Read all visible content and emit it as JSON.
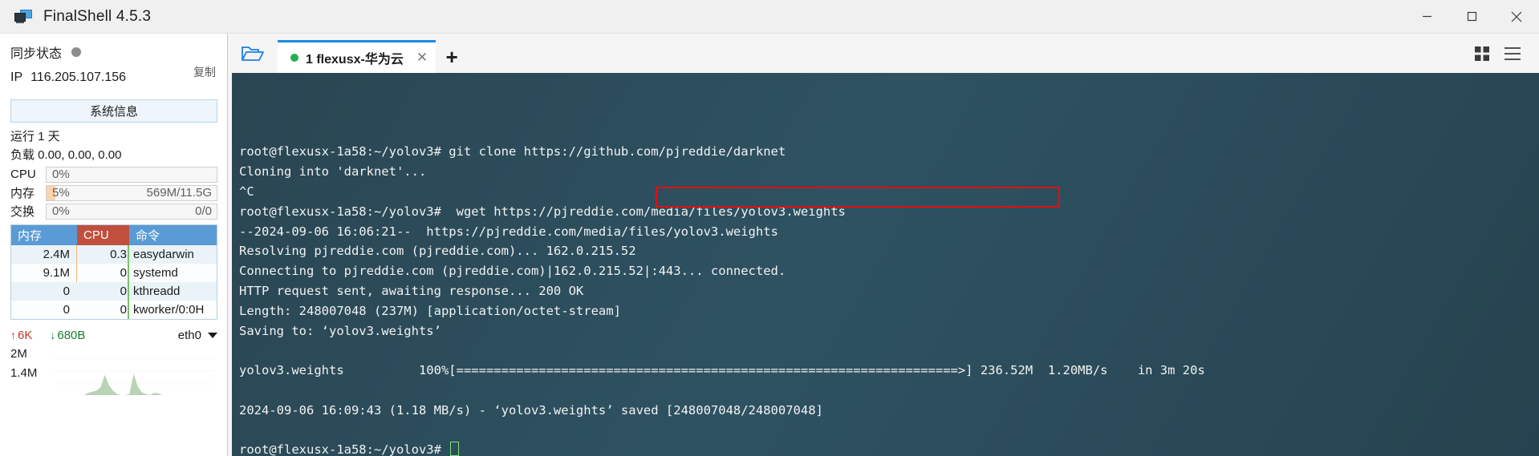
{
  "window": {
    "title": "FinalShell 4.5.3",
    "app_icon": "monitor-icon",
    "minimize": "–",
    "maximize": "□",
    "close": "✕"
  },
  "sidebar": {
    "sync_label": "同步状态",
    "sync_status_color": "#8d8d8d",
    "ip_key": "IP",
    "ip_value": "116.205.107.156",
    "copy_label": "复制",
    "sysinfo_button": "系统信息",
    "uptime": "运行 1 天",
    "load": "负载 0.00, 0.00, 0.00",
    "meters": [
      {
        "label": "CPU",
        "pct": "0%",
        "fill_pct": 0,
        "aux": ""
      },
      {
        "label": "内存",
        "pct": "5%",
        "fill_pct": 5,
        "aux": "569M/11.5G"
      },
      {
        "label": "交换",
        "pct": "0%",
        "fill_pct": 0,
        "aux": "0/0"
      }
    ],
    "proc_table": {
      "headers": {
        "mem": "内存",
        "cpu": "CPU",
        "cmd": "命令"
      },
      "header_colors": {
        "mem": "#5b9bd5",
        "cpu": "#c0503d",
        "cmd": "#5b9bd5"
      },
      "rows": [
        {
          "mem": "2.4M",
          "cpu": "0.3",
          "cmd": "easydarwin"
        },
        {
          "mem": "9.1M",
          "cpu": "0",
          "cmd": "systemd"
        },
        {
          "mem": "0",
          "cpu": "0",
          "cmd": "kthreadd"
        },
        {
          "mem": "0",
          "cpu": "0",
          "cmd": "kworker/0:0H"
        }
      ]
    },
    "net": {
      "up_arrow": "↑",
      "up_value": "6K",
      "down_arrow": "↓",
      "down_value": "680B",
      "interface": "eth0",
      "graph_top_label": "2M",
      "graph_mid_label": "1.4M"
    }
  },
  "tabbar": {
    "folder_icon": "open-folder-icon",
    "tabs": [
      {
        "label": "1 flexusx-华为云",
        "status_color": "#22b14c",
        "close": "✕",
        "active": true
      }
    ],
    "new_tab": "+",
    "right_icons": [
      "grid-view-icon",
      "menu-icon"
    ]
  },
  "terminal": {
    "highlight_color": "#e10f0f",
    "lines": [
      "root@flexusx-1a58:~/yolov3# git clone https://github.com/pjreddie/darknet",
      "Cloning into 'darknet'...",
      "^C",
      "root@flexusx-1a58:~/yolov3#  wget https://pjreddie.com/media/files/yolov3.weights",
      "--2024-09-06 16:06:21--  https://pjreddie.com/media/files/yolov3.weights",
      "Resolving pjreddie.com (pjreddie.com)... 162.0.215.52",
      "Connecting to pjreddie.com (pjreddie.com)|162.0.215.52|:443... connected.",
      "HTTP request sent, awaiting response... 200 OK",
      "Length: 248007048 (237M) [application/octet-stream]",
      "Saving to: ‘yolov3.weights’",
      "",
      "yolov3.weights          100%[===================================================================>] 236.52M  1.20MB/s    in 3m 20s",
      "",
      "2024-09-06 16:09:43 (1.18 MB/s) - ‘yolov3.weights’ saved [248007048/248007048]",
      ""
    ],
    "prompt": "root@flexusx-1a58:~/yolov3# ",
    "cursor": "block-cursor"
  },
  "chart_data": {
    "type": "area",
    "title": "",
    "xlabel": "",
    "ylabel": "",
    "categories": [],
    "values": [
      0,
      0,
      0,
      0,
      0,
      0,
      0,
      0,
      0.1,
      0.15,
      0.2,
      0.35,
      0.9,
      0.45,
      0.2,
      0.05,
      0,
      0,
      0.05,
      0.95,
      0.4,
      0.12,
      0.05,
      0,
      0.1,
      0.08,
      0,
      0,
      0,
      0,
      0,
      0,
      0,
      0,
      0,
      0,
      0,
      0,
      0,
      0
    ],
    "ylim": [
      0,
      2
    ],
    "ytick_labels": [
      "2M",
      "1.4M"
    ],
    "grid": true,
    "series_color": "#b9d3b4"
  }
}
